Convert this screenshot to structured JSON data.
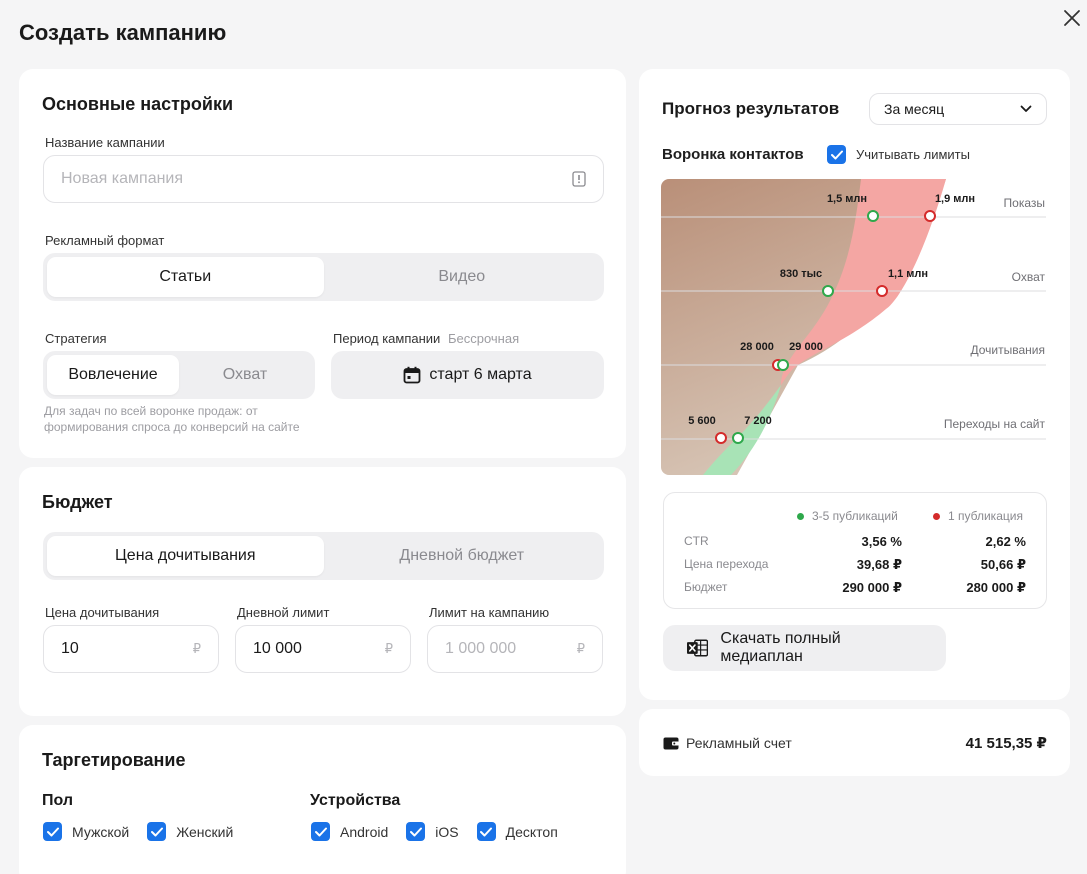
{
  "page": {
    "title": "Создать кампанию"
  },
  "basic": {
    "title": "Основные настройки",
    "name_label": "Название кампании",
    "name_placeholder": "Новая кампания",
    "format_label": "Рекламный формат",
    "format_options": [
      "Статьи",
      "Видео"
    ],
    "strategy_label": "Стратегия",
    "strategy_options": [
      "Вовлечение",
      "Охват"
    ],
    "strategy_hint_1": "Для задач по всей воронке продаж: от",
    "strategy_hint_2": "формирования спроса до конверсий на сайте",
    "period_label": "Период кампании",
    "period_sub": "Бессрочная",
    "period_button": "старт 6 марта"
  },
  "budget": {
    "title": "Бюджет",
    "mode_options": [
      "Цена дочитывания",
      "Дневной бюджет"
    ],
    "price_label": "Цена дочитывания",
    "price_value": "10",
    "daily_label": "Дневной лимит",
    "daily_value": "10 000",
    "campaign_label": "Лимит на кампанию",
    "campaign_placeholder": "1 000 000",
    "currency": "₽"
  },
  "targeting": {
    "title": "Таргетирование",
    "gender_title": "Пол",
    "gender": [
      "Мужской",
      "Женский"
    ],
    "devices_title": "Устройства",
    "devices": [
      "Android",
      "iOS",
      "Десктоп"
    ]
  },
  "forecast": {
    "title": "Прогноз результатов",
    "period_select": "За месяц",
    "funnel_title": "Воронка контактов",
    "limits_checkbox": "Учитывать лимиты",
    "stages": [
      "Показы",
      "Охват",
      "Дочитывания",
      "Переходы на сайт"
    ],
    "green_labels": [
      "1,5 млн",
      "830 тыс",
      "29 000",
      "7 200"
    ],
    "red_labels": [
      "1,9 млн",
      "1,1 млн",
      "28 000",
      "5 600"
    ],
    "legend_green": "3-5 публикаций",
    "legend_red": "1 публикация",
    "rows": [
      {
        "label": "CTR",
        "green": "3,56 %",
        "red": "2,62 %"
      },
      {
        "label": "Цена перехода",
        "green": "39,68 ₽",
        "red": "50,66 ₽"
      },
      {
        "label": "Бюджет",
        "green": "290 000 ₽",
        "red": "280 000 ₽"
      }
    ],
    "download_button": "Скачать полный медиаплан"
  },
  "account": {
    "label": "Рекламный счет",
    "balance": "41 515,35 ₽"
  },
  "colors": {
    "accent": "#1a73e8",
    "green": "#2ea84b",
    "red": "#d42b2b"
  }
}
